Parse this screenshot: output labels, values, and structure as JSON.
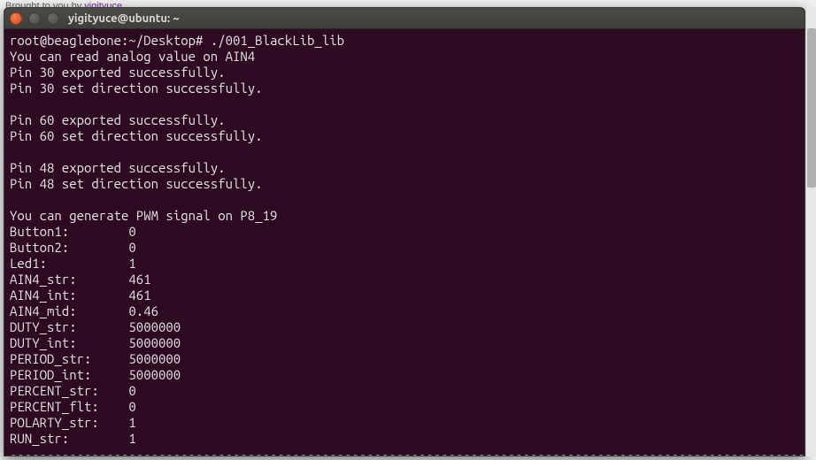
{
  "browser_hint_prefix": "Brought to you by ",
  "browser_hint_link": "yigityuce",
  "window": {
    "title": "yigityuce@ubuntu: ~"
  },
  "terminal": {
    "prompt": "root@beaglebone:~/Desktop# ",
    "command": "./001_BlackLib_lib",
    "lines": [
      "You can read analog value on AIN4",
      "Pin 30 exported successfully.",
      "Pin 30 set direction successfully.",
      "",
      "Pin 60 exported successfully.",
      "Pin 60 set direction successfully.",
      "",
      "Pin 48 exported successfully.",
      "Pin 48 set direction successfully.",
      "",
      "You can generate PWM signal on P8_19",
      "Button1:        0",
      "Button2:        0",
      "Led1:           1",
      "AIN4_str:       461",
      "AIN4_int:       461",
      "AIN4_mid:       0.46",
      "DUTY_str:       5000000",
      "DUTY_int:       5000000",
      "PERIOD_str:     5000000",
      "PERIOD_int:     5000000",
      "PERCENT_str:    0",
      "PERCENT_flt:    0",
      "POLARTY_str:    1",
      "RUN_str:        1",
      "--------------------------------------------------------------------------------------------------------------------"
    ]
  }
}
